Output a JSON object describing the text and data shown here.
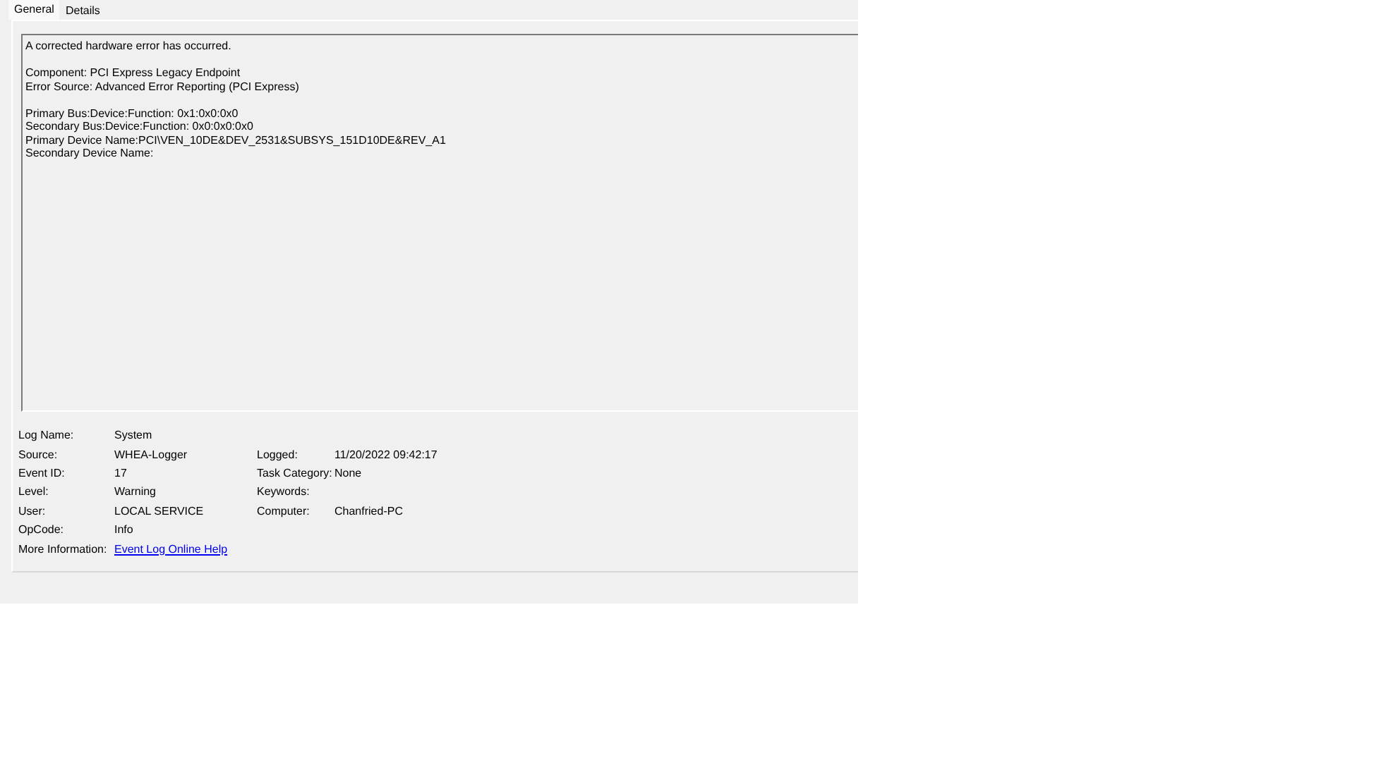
{
  "tabs": [
    {
      "label": "General",
      "selected": true
    },
    {
      "label": "Details",
      "selected": false
    }
  ],
  "message": {
    "paragraphs": [
      [
        "A corrected hardware error has occurred."
      ],
      [
        "Component: PCI Express Legacy Endpoint",
        "Error Source: Advanced Error Reporting (PCI Express)"
      ],
      [
        "Primary Bus:Device:Function: 0x1:0x0:0x0",
        "Secondary Bus:Device:Function: 0x0:0x0:0x0",
        "Primary Device Name:PCI\\VEN_10DE&DEV_2531&SUBSYS_151D10DE&REV_A1",
        "Secondary Device Name:"
      ]
    ]
  },
  "details": {
    "left": [
      {
        "label": "Log Name:",
        "value": "System"
      },
      {
        "label": "Source:",
        "value": "WHEA-Logger"
      },
      {
        "label": "Event ID:",
        "value": "17"
      },
      {
        "label": "Level:",
        "value": "Warning"
      },
      {
        "label": "User:",
        "value": "LOCAL SERVICE"
      },
      {
        "label": "OpCode:",
        "value": "Info"
      },
      {
        "label": "More Information:",
        "value": "Event Log Online Help",
        "kind": "link"
      }
    ],
    "right": [
      {
        "label": "Logged:",
        "value": "11/20/2022 09:42:17"
      },
      {
        "label": "Task Category:",
        "value": "None"
      },
      {
        "label": "Keywords:"
      },
      {
        "label": "Computer:",
        "value": "Chanfried-PC"
      }
    ]
  }
}
